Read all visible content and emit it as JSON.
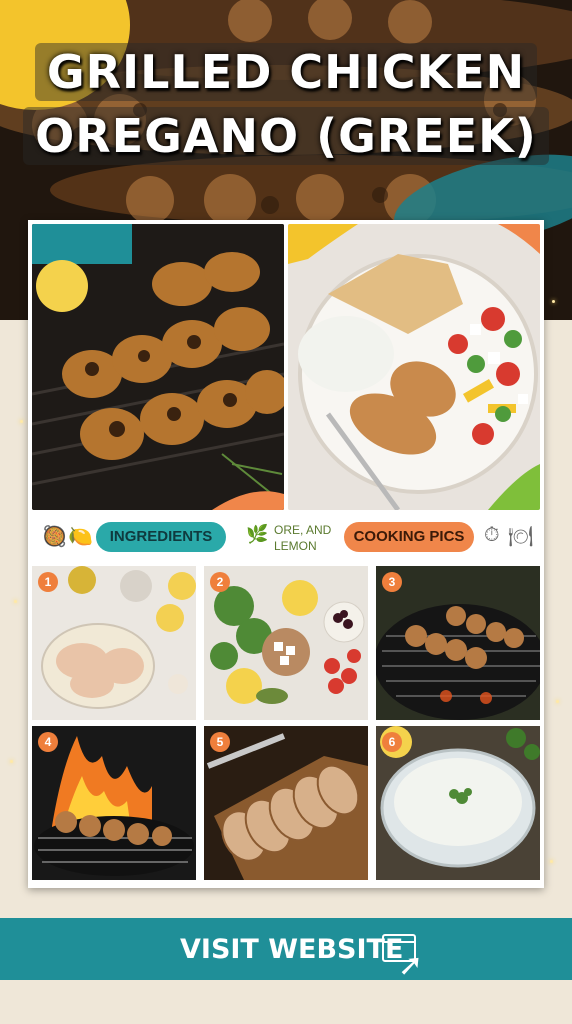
{
  "title": {
    "line1": "GRILLED CHICKEN",
    "line2": "OREGANO (GREEK)"
  },
  "labels": {
    "ingredients": "INGREDIENTS",
    "center_note_line1": "ORE, AND",
    "center_note_line2": "LEMON",
    "cooking_pics": "COOKING PICS"
  },
  "steps": [
    "1",
    "2",
    "3",
    "4",
    "5",
    "6"
  ],
  "cta": {
    "label": "VISIT WEBSITE"
  },
  "colors": {
    "teal": "#1f8f98",
    "orange": "#ef7f3c",
    "yellow": "#f3c42c"
  },
  "icons": [
    "lemon-icon",
    "garlic-icon",
    "herb-icon",
    "pot-icon",
    "cloche-icon",
    "browser-icon",
    "cursor-icon"
  ]
}
